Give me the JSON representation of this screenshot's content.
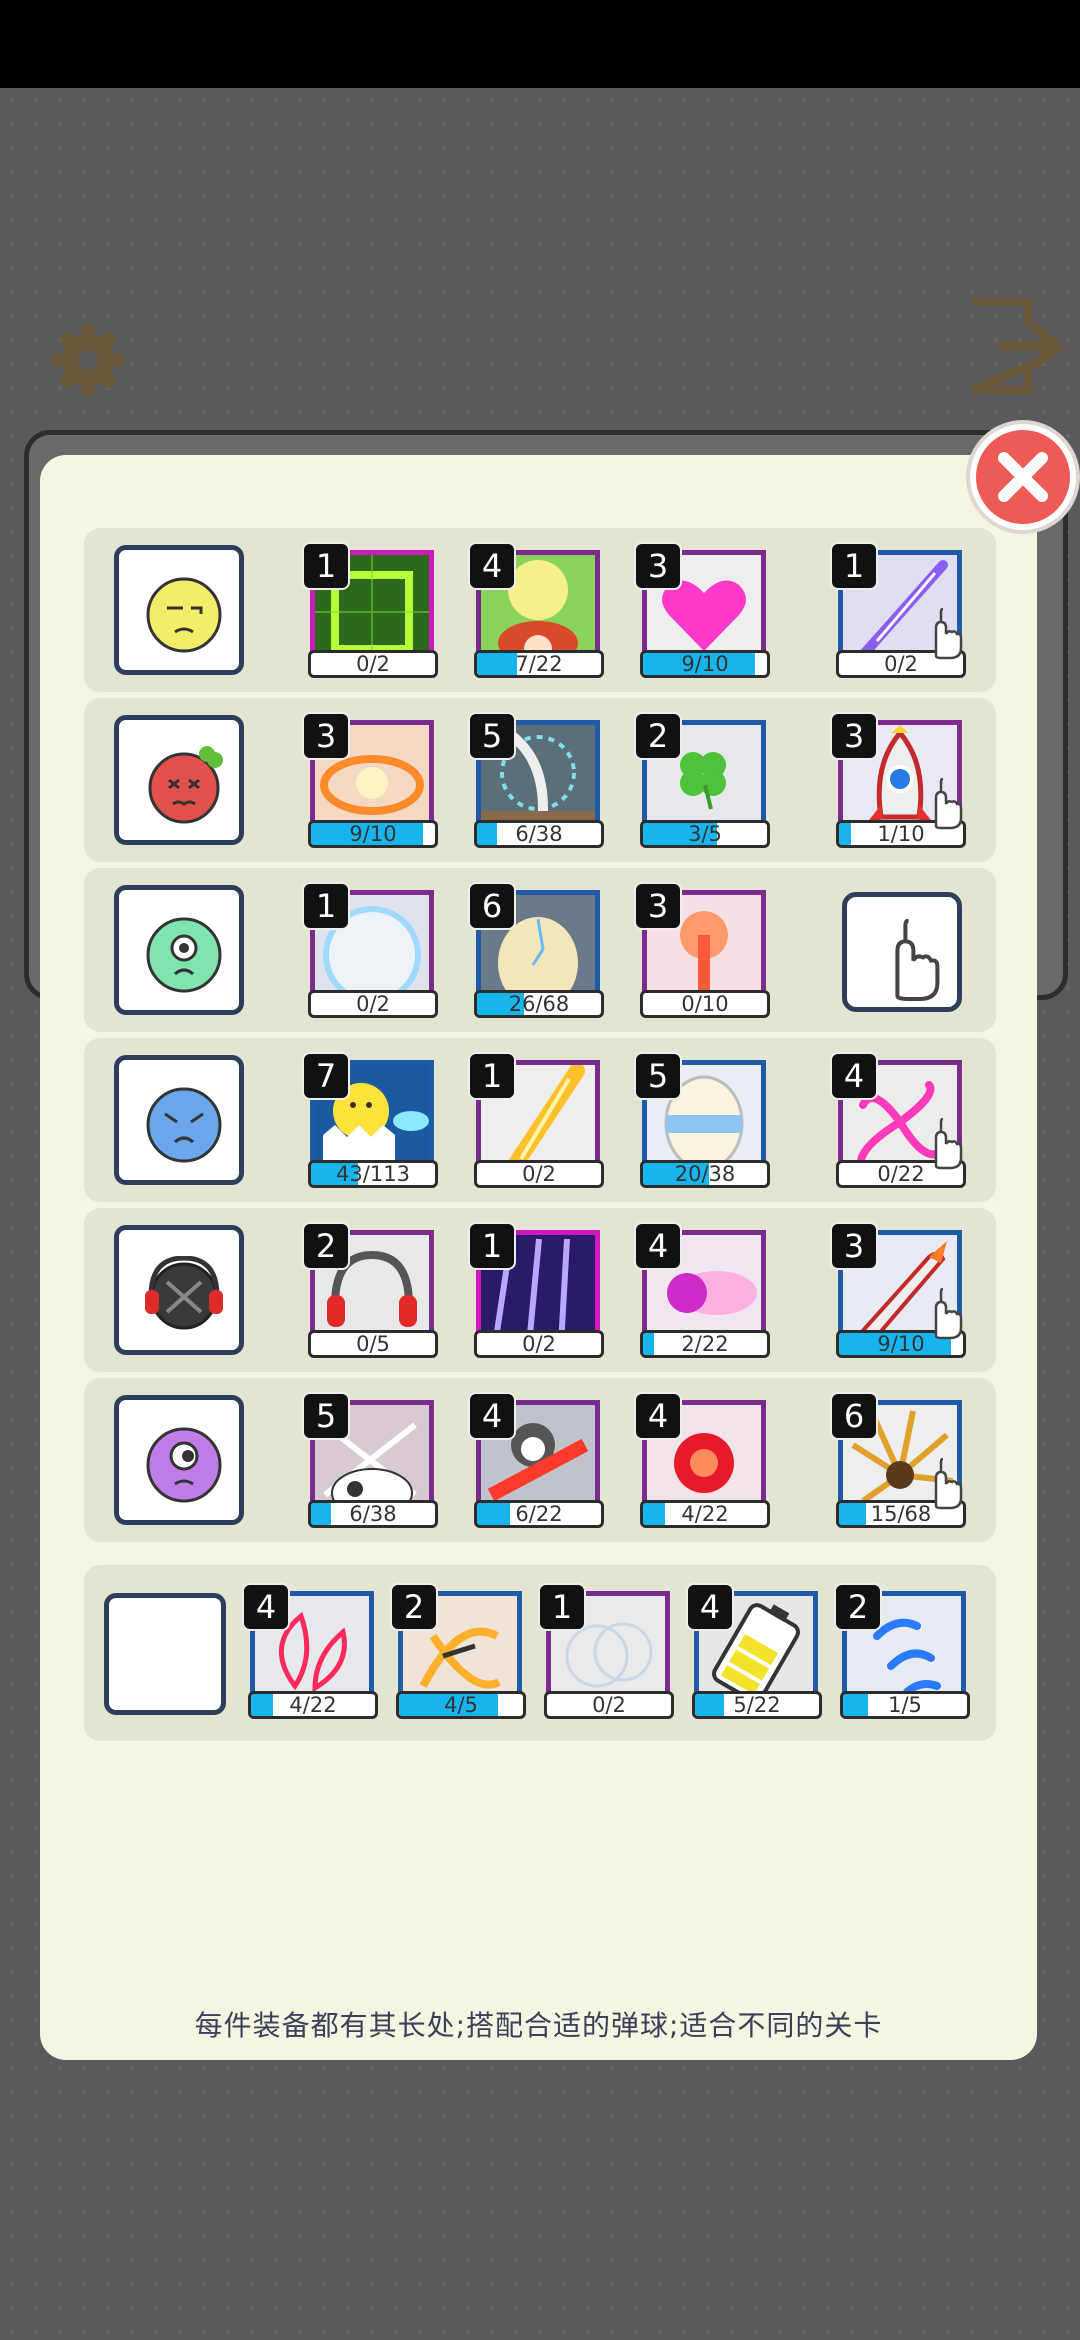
{
  "hint": "每件装备都有其长处;搭配合适的弹球;适合不同的关卡",
  "rows": [
    {
      "character": "yellow-neutral-face",
      "slots": [
        {
          "level": "1",
          "progress": "0/2",
          "icon": "green-square-frame"
        },
        {
          "level": "4",
          "progress": "7/22",
          "icon": "mushroom-explosion"
        },
        {
          "level": "3",
          "progress": "9/10",
          "icon": "pink-heart"
        },
        {
          "level": "1",
          "progress": "0/2",
          "icon": "purple-lightning-slash"
        }
      ]
    },
    {
      "character": "red-angry-face-clover",
      "slots": [
        {
          "level": "3",
          "progress": "9/10",
          "icon": "orange-fire-ring"
        },
        {
          "level": "5",
          "progress": "6/38",
          "icon": "curved-sword"
        },
        {
          "level": "2",
          "progress": "3/5",
          "icon": "four-leaf-clover"
        },
        {
          "level": "3",
          "progress": "1/10",
          "icon": "rocket"
        }
      ]
    },
    {
      "character": "green-one-eye-face",
      "slots": [
        {
          "level": "1",
          "progress": "0/2",
          "icon": "blue-bubble-ring"
        },
        {
          "level": "6",
          "progress": "26/68",
          "icon": "cracked-egg"
        },
        {
          "level": "3",
          "progress": "0/10",
          "icon": "red-explosion"
        }
      ],
      "empty_slot": "hand-icon"
    },
    {
      "character": "blue-sleepy-face",
      "slots": [
        {
          "level": "7",
          "progress": "43/113",
          "icon": "chick-in-egg"
        },
        {
          "level": "1",
          "progress": "0/2",
          "icon": "yellow-slash"
        },
        {
          "level": "5",
          "progress": "20/38",
          "icon": "striped-egg"
        },
        {
          "level": "4",
          "progress": "0/22",
          "icon": "pink-vortex"
        }
      ]
    },
    {
      "character": "headphone-dark-face",
      "slots": [
        {
          "level": "2",
          "progress": "0/5",
          "icon": "red-headphones"
        },
        {
          "level": "1",
          "progress": "0/2",
          "icon": "purple-claw-lightning"
        },
        {
          "level": "4",
          "progress": "2/22",
          "icon": "magenta-energy-burst"
        },
        {
          "level": "3",
          "progress": "9/10",
          "icon": "flaming-rocket"
        }
      ]
    },
    {
      "character": "purple-cyclops-face",
      "slots": [
        {
          "level": "5",
          "progress": "6/38",
          "icon": "cow-swords"
        },
        {
          "level": "4",
          "progress": "6/22",
          "icon": "penguin-fire"
        },
        {
          "level": "4",
          "progress": "4/22",
          "icon": "red-flame-orb"
        },
        {
          "level": "6",
          "progress": "15/68",
          "icon": "golden-spike-burst"
        }
      ]
    }
  ],
  "bottom_row": {
    "slots": [
      {
        "level": "4",
        "progress": "4/22",
        "icon": "red-petal-wing"
      },
      {
        "level": "2",
        "progress": "4/5",
        "icon": "golden-whirl"
      },
      {
        "level": "1",
        "progress": "0/2",
        "icon": "soap-bubbles"
      },
      {
        "level": "4",
        "progress": "5/22",
        "icon": "yellow-battery"
      },
      {
        "level": "2",
        "progress": "1/5",
        "icon": "blue-droplets"
      }
    ]
  },
  "fills": {
    "row0": [
      0.0,
      0.32,
      0.9,
      0.0
    ],
    "row1": [
      0.9,
      0.16,
      0.6,
      0.1
    ],
    "row2": [
      0.0,
      0.38,
      0.0
    ],
    "row3": [
      0.38,
      0.0,
      0.53,
      0.0
    ],
    "row4": [
      0.0,
      0.0,
      0.09,
      0.9
    ],
    "row5": [
      0.16,
      0.27,
      0.18,
      0.22
    ],
    "bottom": [
      0.18,
      0.8,
      0.0,
      0.23,
      0.2
    ]
  },
  "colors": {
    "accent": "#17b5ee",
    "close": "#ef5a55",
    "panel": "#f5f6e2"
  }
}
